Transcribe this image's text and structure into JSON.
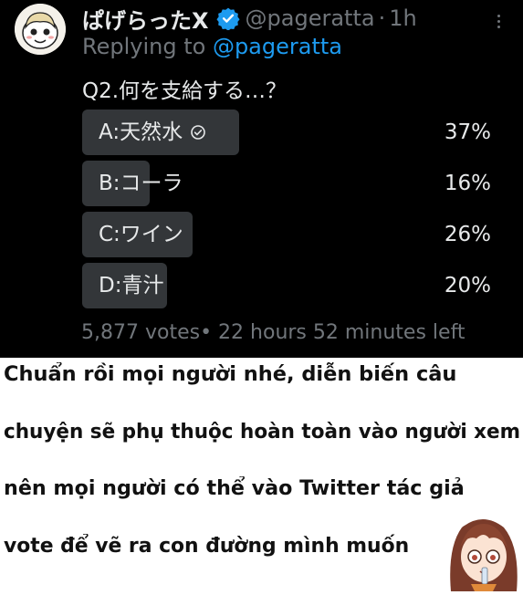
{
  "tweet": {
    "display_name": "ぱげらったX",
    "handle": "@pageratta",
    "separator": "·",
    "time": "1h",
    "replying_prefix": "Replying to ",
    "replying_handle": "@pageratta",
    "question": "Q2.何を支給する…？",
    "poll": {
      "options": [
        {
          "label": "A:天然水",
          "percent_text": "37%",
          "percent": 37,
          "selected": true
        },
        {
          "label": "B:コーラ",
          "percent_text": "16%",
          "percent": 16,
          "selected": false
        },
        {
          "label": "C:ワイン",
          "percent_text": "26%",
          "percent": 26,
          "selected": false
        },
        {
          "label": "D:青汁",
          "percent_text": "20%",
          "percent": 20,
          "selected": false
        }
      ],
      "votes_text": "5,877 votes",
      "bullet": "•",
      "time_left": " 22 hours 52 minutes left"
    }
  },
  "caption": {
    "lines": [
      "Chuẩn rồi mọi người nhé, diễn biến câu",
      "chuyện sẽ phụ thuộc hoàn toàn vào người xem",
      "nên mọi người có thể vào Twitter tác giả",
      "vote để vẽ ra con đường mình muốn"
    ]
  },
  "colors": {
    "background": "#000000",
    "text": "#e7e9ea",
    "secondary": "#71767b",
    "accent": "#1d9bf0",
    "poll_bar": "#333639"
  },
  "icons": {
    "verified": "verified-badge-icon",
    "selected": "check-circle-icon",
    "more": "more-options-icon"
  }
}
